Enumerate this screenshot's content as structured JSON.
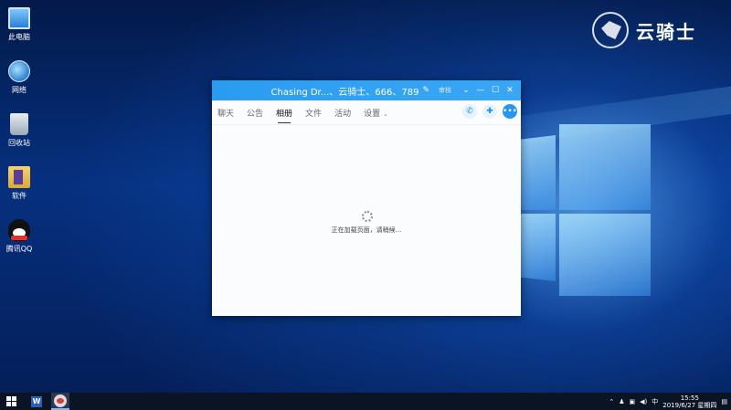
{
  "watermark": {
    "brand": "云骑士"
  },
  "desktop": {
    "icons": [
      {
        "label": "此电脑"
      },
      {
        "label": "网络"
      },
      {
        "label": "回收站"
      },
      {
        "label": "软件"
      },
      {
        "label": "腾讯QQ"
      }
    ]
  },
  "qq_window": {
    "title": "Chasing Dr...、云骑士、666、789",
    "badge": "审核",
    "tabs": [
      {
        "label": "聊天"
      },
      {
        "label": "公告"
      },
      {
        "label": "相册"
      },
      {
        "label": "文件"
      },
      {
        "label": "活动"
      },
      {
        "label": "设置"
      }
    ],
    "active_tab": "相册",
    "loading_text": "正在加载页面，请稍候..."
  },
  "taskbar": {
    "ime": "中",
    "time": "15:55",
    "date": "2019/6/27 星期四"
  },
  "colors": {
    "titlebar": "#2a9cf0",
    "desktop_bg": "#06307f",
    "taskbar_bg": "#0b1424"
  }
}
